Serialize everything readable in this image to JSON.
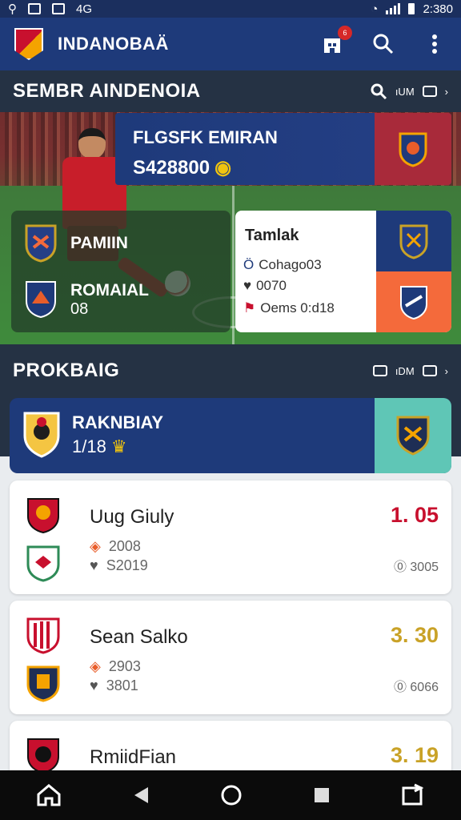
{
  "status_bar": {
    "time": "2:380",
    "left_icons": [
      "wifi-calling-icon",
      "photo-icon",
      "message-icon"
    ],
    "network": "4G"
  },
  "app": {
    "title": "INDANOBAÄ",
    "notification_count": "6"
  },
  "section1": {
    "title": "SEMBR AINDENOIA",
    "tool_label": "ıUM"
  },
  "hero_card": {
    "title": "FLGSFK EMIRAN",
    "value": "S428800"
  },
  "overlay": {
    "team1": "PAMIIN",
    "team2": "ROMAIAL",
    "team2_sub": "08"
  },
  "info_card": {
    "title": "Tamlak",
    "rows": [
      "Cohago03",
      "0070",
      "Oems 0:d18"
    ]
  },
  "section2": {
    "title": "PROKBAIG",
    "tool_label": "ıDM"
  },
  "highlight": {
    "title": "RAKNBIAY",
    "value": "1/18"
  },
  "list": [
    {
      "name": "Uug Giuly",
      "odds": "1. 05",
      "odds_color": "#c8102e",
      "stat1": "2008",
      "stat2": "S2019",
      "side": "⓪ 3005"
    },
    {
      "name": "Sean Salko",
      "odds": "3. 30",
      "odds_color": "#c9a227",
      "stat1": "2903",
      "stat2": "3801",
      "side": "⓪ 6066"
    },
    {
      "name": "RmiidFian",
      "odds": "3. 19",
      "odds_color": "#c9a227"
    }
  ],
  "colors": {
    "primary": "#1e3a7a",
    "header_dark": "#253244",
    "accent_red": "#c8102e",
    "accent_gold": "#c9a227"
  }
}
